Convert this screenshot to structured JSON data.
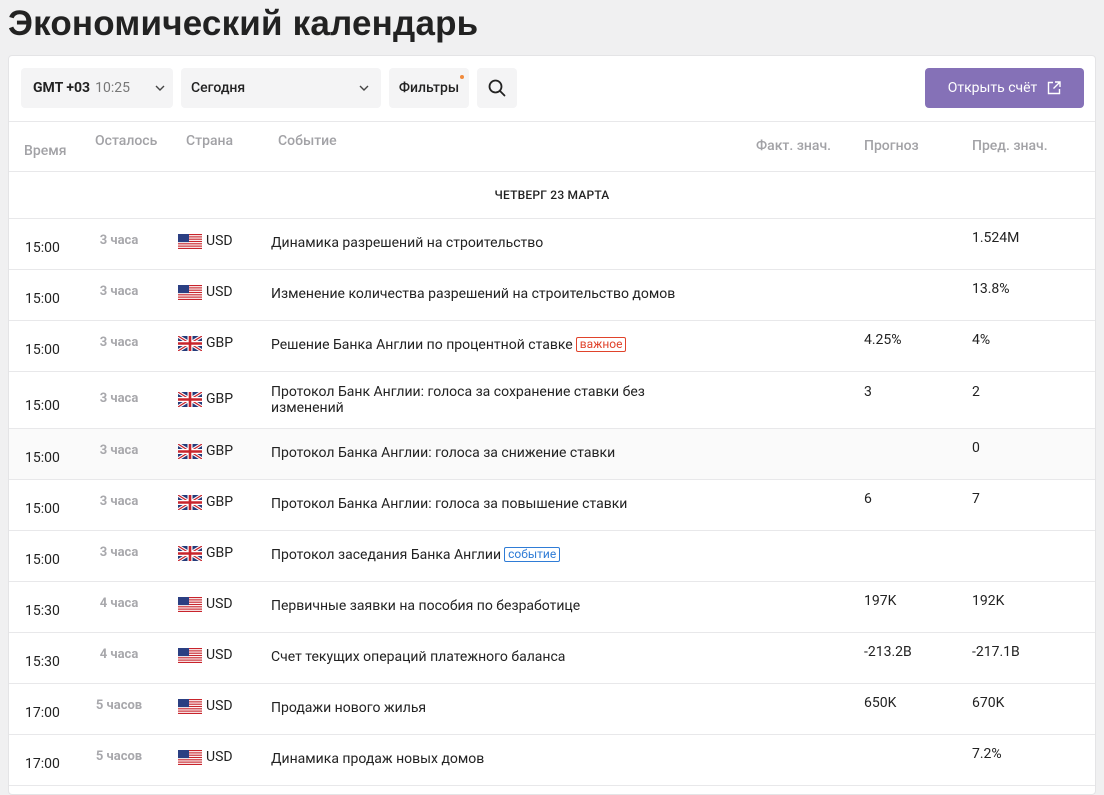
{
  "title": "Экономический календарь",
  "toolbar": {
    "timezone_label": "GMT +03",
    "timezone_time": "10:25",
    "day_value": "Сегодня",
    "filters_label": "Фильтры",
    "open_account_label": "Открыть счёт"
  },
  "table": {
    "headers": {
      "time": "Время",
      "left": "Осталось",
      "country": "Страна",
      "event": "Событие",
      "actual": "Факт. знач.",
      "forecast": "Прогноз",
      "previous": "Пред. знач."
    },
    "day_label": "ЧЕТВЕРГ 23 МАРТА",
    "badges": {
      "important": "важное",
      "event": "событие"
    },
    "rows": [
      {
        "time": "15:00",
        "left": "3 часа",
        "flag": "us",
        "currency": "USD",
        "event": "Динамика разрешений на строительство",
        "forecast": "",
        "previous": "1.524M"
      },
      {
        "time": "15:00",
        "left": "3 часа",
        "flag": "us",
        "currency": "USD",
        "event": "Изменение количества разрешений на строительство домов",
        "forecast": "",
        "previous": "13.8%"
      },
      {
        "time": "15:00",
        "left": "3 часа",
        "flag": "gb",
        "currency": "GBP",
        "event": "Решение Банка Англии по процентной ставке",
        "badge": "важное",
        "forecast": "4.25%",
        "previous": "4%"
      },
      {
        "time": "15:00",
        "left": "3 часа",
        "flag": "gb",
        "currency": "GBP",
        "event": "Протокол Банк Англии: голоса за сохранение ставки без изменений",
        "forecast": "3",
        "previous": "2"
      },
      {
        "time": "15:00",
        "left": "3 часа",
        "flag": "gb",
        "currency": "GBP",
        "event": "Протокол Банка Англии: голоса за снижение ставки",
        "forecast": "",
        "previous": "0"
      },
      {
        "time": "15:00",
        "left": "3 часа",
        "flag": "gb",
        "currency": "GBP",
        "event": "Протокол Банка Англии: голоса за повышение ставки",
        "forecast": "6",
        "previous": "7"
      },
      {
        "time": "15:00",
        "left": "3 часа",
        "flag": "gb",
        "currency": "GBP",
        "event": "Протокол заседания Банка Англии",
        "badge": "событие",
        "forecast": "",
        "previous": ""
      },
      {
        "time": "15:30",
        "left": "4 часа",
        "flag": "us",
        "currency": "USD",
        "event": "Первичные заявки на пособия по безработице",
        "forecast": "197K",
        "previous": "192K"
      },
      {
        "time": "15:30",
        "left": "4 часа",
        "flag": "us",
        "currency": "USD",
        "event": "Счет текущих операций платежного баланса",
        "forecast": "-213.2B",
        "previous": "-217.1B"
      },
      {
        "time": "17:00",
        "left": "5 часов",
        "flag": "us",
        "currency": "USD",
        "event": "Продажи нового жилья",
        "forecast": "650K",
        "previous": "670K"
      },
      {
        "time": "17:00",
        "left": "5 часов",
        "flag": "us",
        "currency": "USD",
        "event": "Динамика продаж новых домов",
        "forecast": "",
        "previous": "7.2%"
      }
    ]
  }
}
